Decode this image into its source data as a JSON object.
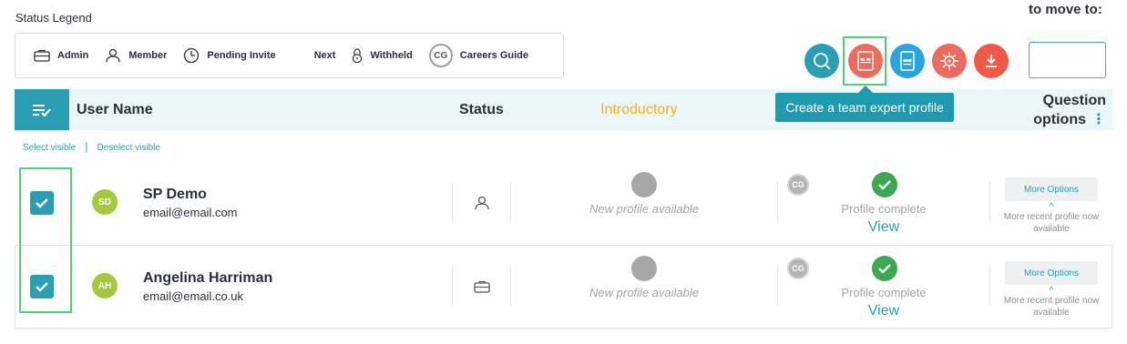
{
  "legend": {
    "title": "Status Legend",
    "items": [
      {
        "label": "Admin",
        "icon": "briefcase-icon"
      },
      {
        "label": "Member",
        "icon": "person-icon"
      },
      {
        "label": "Pending Invite",
        "icon": "clock-icon"
      },
      {
        "label": "Next",
        "icon": ""
      },
      {
        "label": "Withheld",
        "icon": "lock-icon"
      },
      {
        "label": "Careers Guide",
        "icon": "cg-badge",
        "badge": "CG"
      }
    ]
  },
  "move": {
    "label": "to move to:",
    "value": ""
  },
  "toolbar": {
    "tooltip": "Create a team expert profile",
    "buttons": [
      "search-icon",
      "team-expert-profile-icon",
      "profile-icon",
      "virus-icon",
      "download-icon"
    ],
    "colors": {
      "teal": "#2a9fb3",
      "coral": "#ee6a5c",
      "blue": "#26a6e0",
      "orange": "#ee5a45",
      "highlight": "#4cd37a"
    }
  },
  "table": {
    "headers": {
      "user": "User Name",
      "status": "Status",
      "intro": "Introductory",
      "question_options": "Question options",
      "kebab": "⋮"
    },
    "select_visible": "Select visible",
    "separator": "|",
    "deselect_visible": "Deselect visible",
    "rows": [
      {
        "initials": "SD",
        "name": "SP Demo",
        "email": "email@email.com",
        "status_icon": "person-icon",
        "intro": "New profile available",
        "cg": "CG",
        "profile": "Profile complete",
        "view": "View",
        "more": "More Options",
        "caret": "^",
        "recent": "More recent profile now available",
        "checked": true
      },
      {
        "initials": "AH",
        "name": "Angelina Harriman",
        "email": "email@email.co.uk",
        "status_icon": "briefcase-icon",
        "intro": "New profile available",
        "cg": "CG",
        "profile": "Profile complete",
        "view": "View",
        "more": "More Options",
        "caret": "^",
        "recent": "More recent profile now available",
        "checked": true
      }
    ]
  }
}
